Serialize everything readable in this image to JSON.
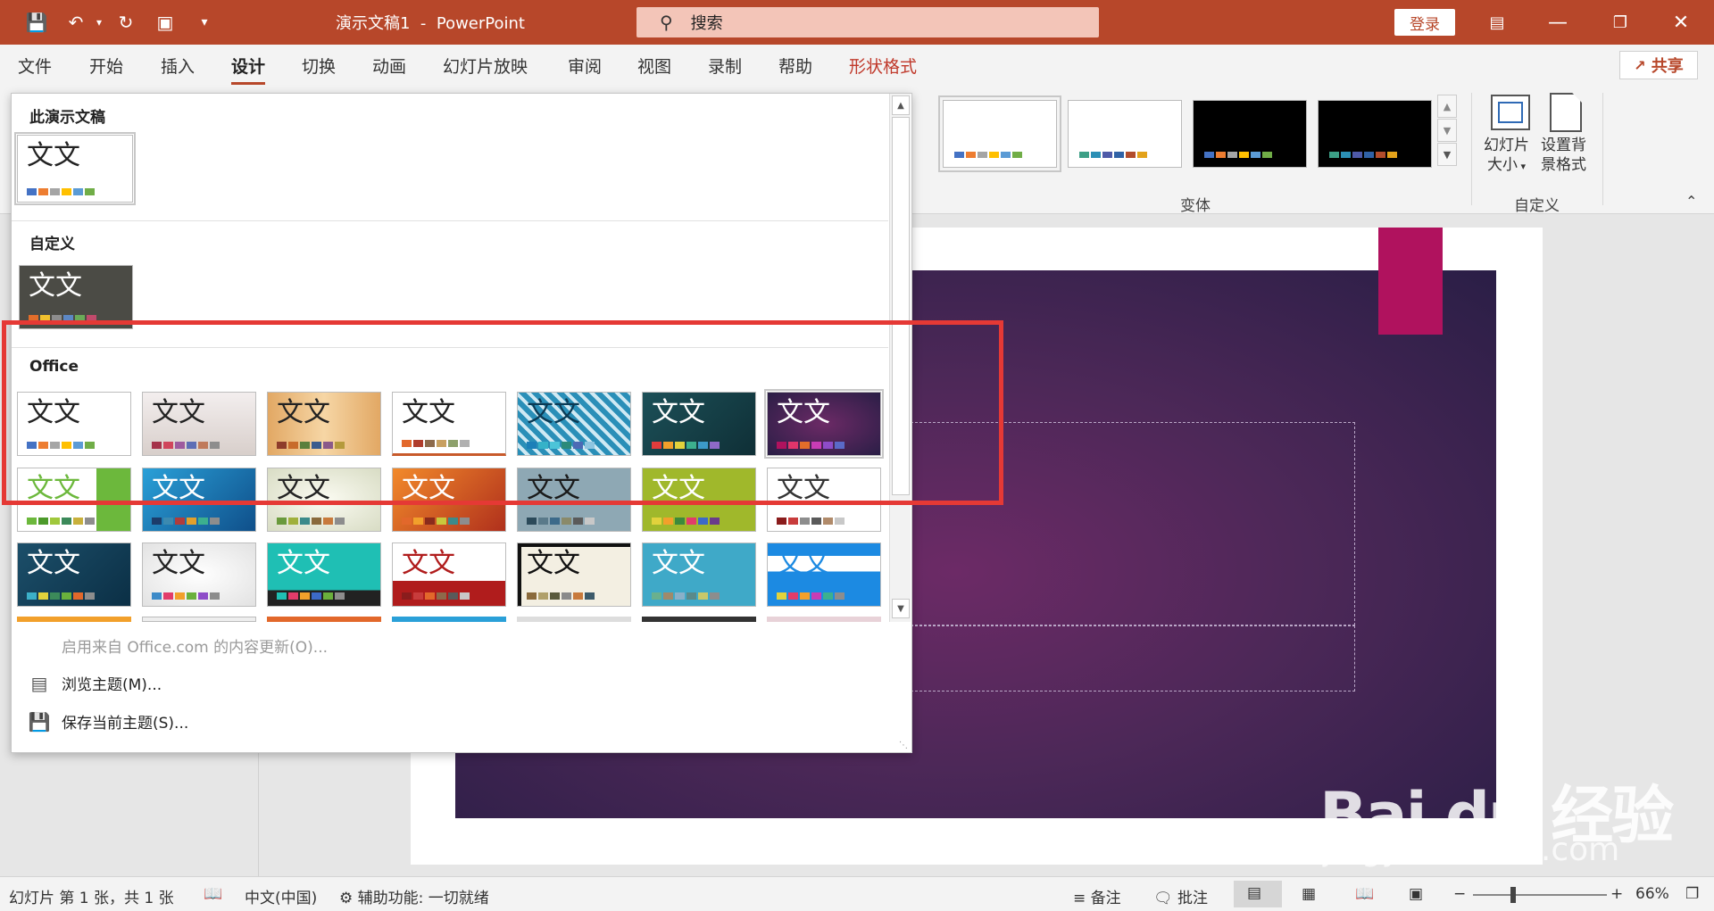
{
  "title_bar": {
    "doc_name": "演示文稿1",
    "separator": "-",
    "app_name": "PowerPoint",
    "search_placeholder": "搜索",
    "login": "登录"
  },
  "tabs": [
    "文件",
    "开始",
    "插入",
    "设计",
    "切换",
    "动画",
    "幻灯片放映",
    "审阅",
    "视图",
    "录制",
    "帮助",
    "形状格式"
  ],
  "active_tab": "设计",
  "share": "共享",
  "ribbon": {
    "variants_group": "变体",
    "customize_group": "自定义",
    "slide_size_line1": "幻灯片",
    "slide_size_line2": "大小",
    "bg_format_line1": "设置背",
    "bg_format_line2": "景格式"
  },
  "dropdown": {
    "section_this": "此演示文稿",
    "section_custom": "自定义",
    "section_office": "Office",
    "thumb_text": "文文",
    "enable_updates": "启用来自 Office.com 的内容更新(O)...",
    "browse_themes": "浏览主题(M)...",
    "save_theme": "保存当前主题(S)..."
  },
  "status": {
    "slide_info": "幻灯片 第 1 张，共 1 张",
    "language": "中文(中国)",
    "accessibility": "辅助功能: 一切就绪",
    "notes": "备注",
    "comments": "批注",
    "zoom": "66%"
  },
  "watermark": {
    "brand": "Bai du 经验",
    "url": "jingyan.baidu.com"
  },
  "colors": {
    "accent": "#b7472a",
    "highlight_box": "#e53935",
    "slide_bg": "#4d2858",
    "bookmark": "#b0125e"
  }
}
